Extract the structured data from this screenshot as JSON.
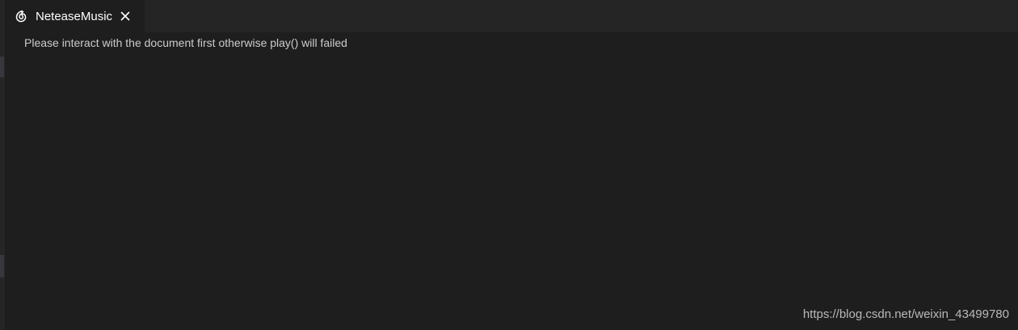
{
  "tab": {
    "title": "NeteaseMusic",
    "icon": "netease-music-icon",
    "close_icon": "close-icon"
  },
  "content": {
    "message": "Please interact with the document first otherwise play() will failed"
  },
  "watermark": {
    "text": "https://blog.csdn.net/weixin_43499780"
  },
  "colors": {
    "editor_background": "#1e1e1e",
    "tabbar_background": "#252526",
    "tab_text": "#ffffff",
    "message_text": "#cccccc"
  }
}
